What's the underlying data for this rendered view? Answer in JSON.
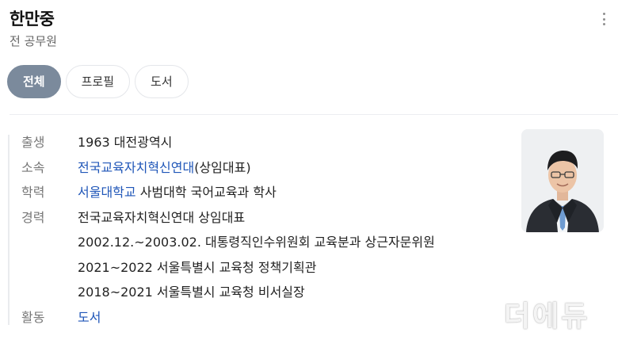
{
  "profile": {
    "name": "한만중",
    "occupation": "전 공무원"
  },
  "tabs": [
    {
      "label": "전체",
      "active": true
    },
    {
      "label": "프로필",
      "active": false
    },
    {
      "label": "도서",
      "active": false
    }
  ],
  "info": {
    "birth": {
      "label": "출생",
      "value": "1963 대전광역시"
    },
    "affiliation": {
      "label": "소속",
      "link": "전국교육자치혁신연대",
      "suffix": "(상임대표)"
    },
    "education": {
      "label": "학력",
      "link": "서울대학교",
      "suffix": " 사범대학 국어교육과 학사"
    },
    "career": {
      "label": "경력",
      "items": [
        "전국교육자치혁신연대 상임대표",
        "2002.12.~2003.02. 대통령직인수위원회 교육분과 상근자문위원",
        "2021~2022 서울특별시 교육청 정책기획관",
        "2018~2021 서울특별시 교육청 비서실장"
      ]
    },
    "activity": {
      "label": "활동",
      "link": "도서"
    }
  },
  "watermark": {
    "text": "더에듀"
  },
  "colors": {
    "active_tab_bg": "#7b8a9c",
    "link": "#1f56b8",
    "label": "#777777"
  },
  "icons": {
    "more": "more-vertical-icon"
  }
}
